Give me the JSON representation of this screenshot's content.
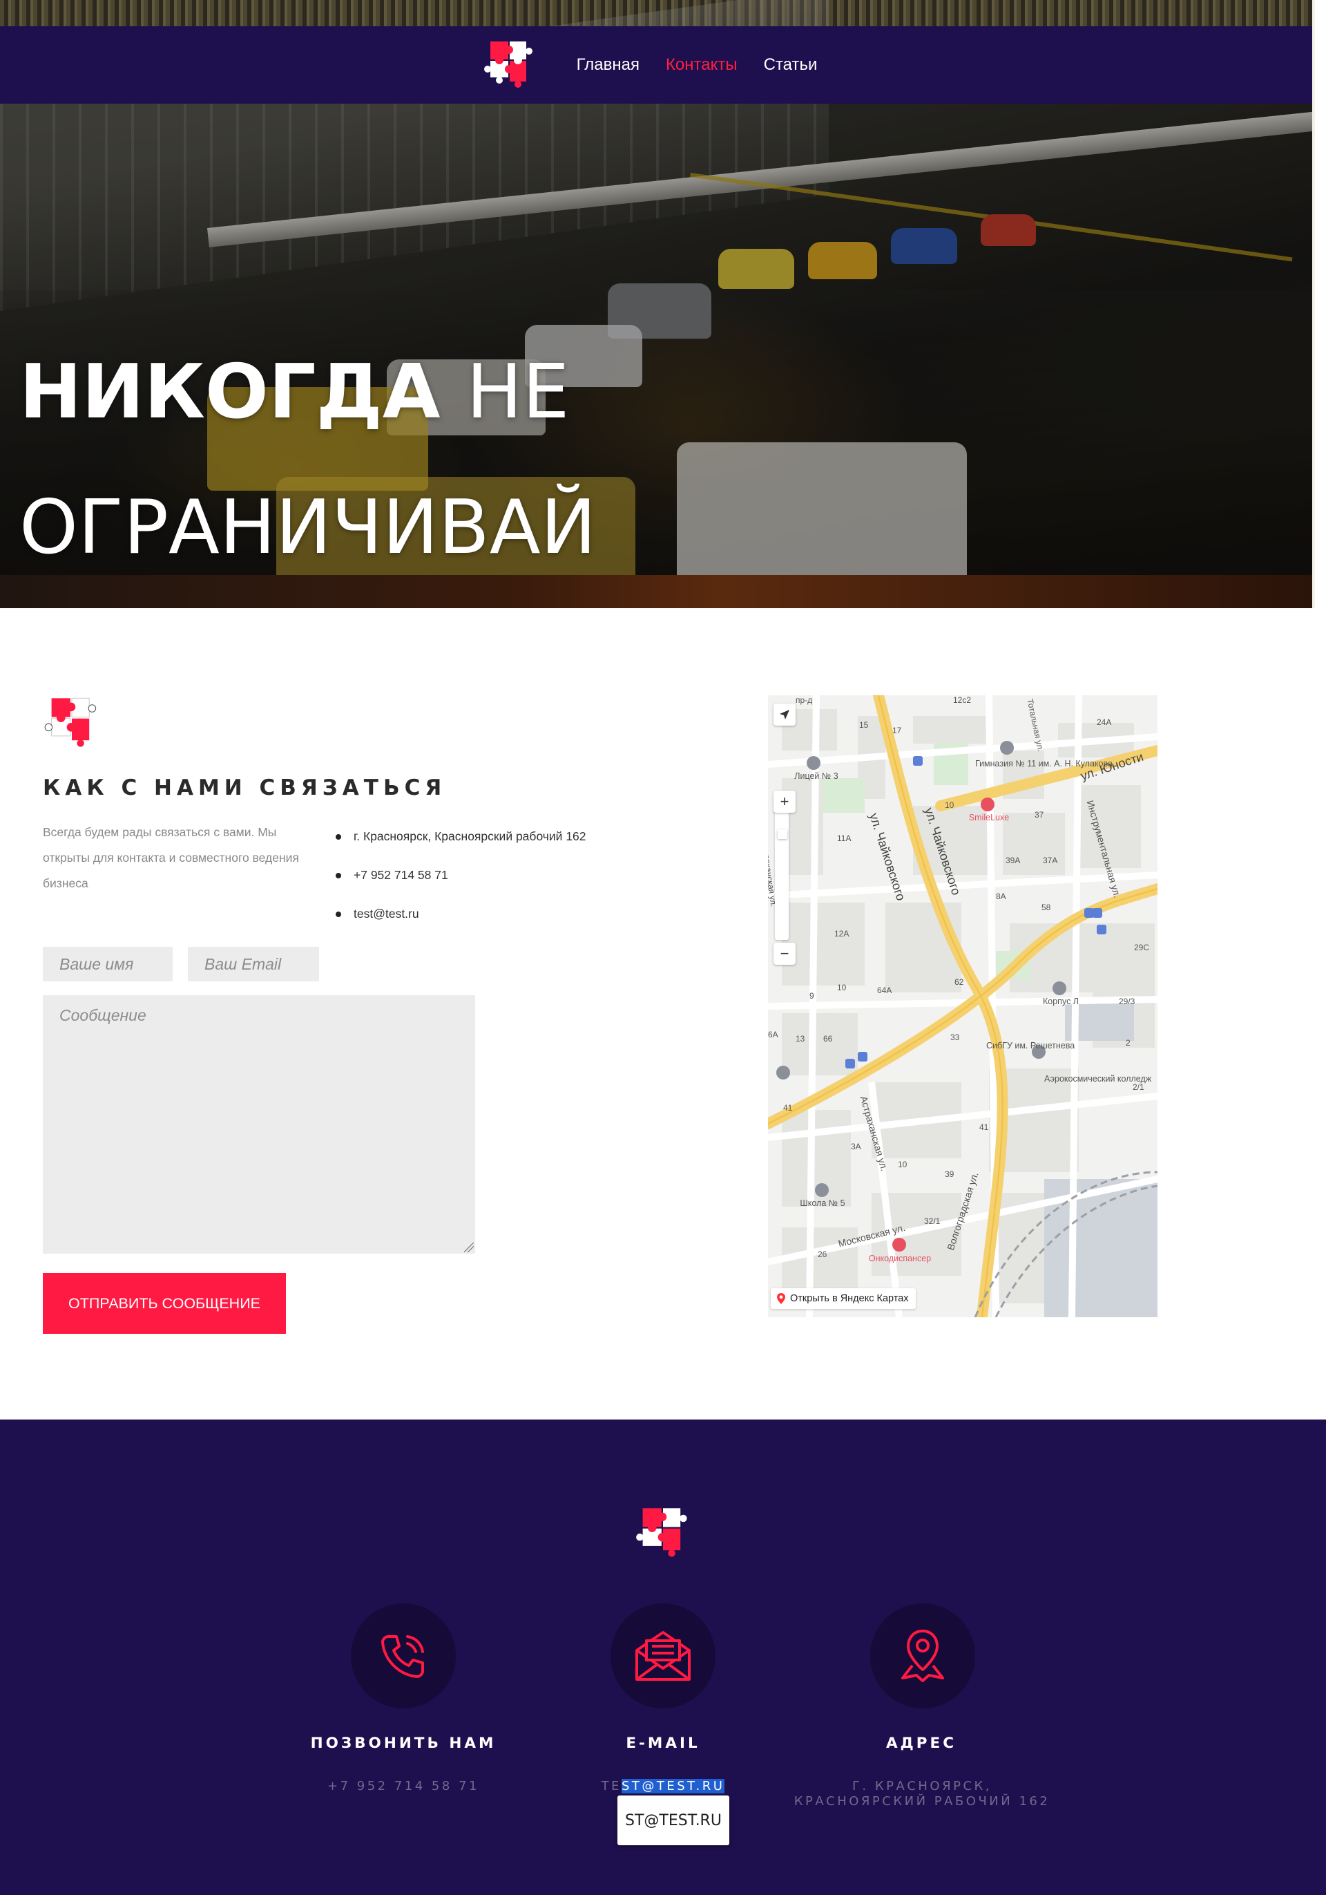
{
  "nav": {
    "links": [
      {
        "label": "Главная"
      },
      {
        "label": "Контакты"
      },
      {
        "label": "Статьи"
      }
    ],
    "active_color": "#ff1f3f",
    "background": "#1e0f4e"
  },
  "hero": {
    "title_bold": "НИКОГДА",
    "title_rest": "НЕ",
    "title_line2": "ОГРАНИЧИВАЙ"
  },
  "contact": {
    "heading": "КАК С НАМИ СВЯЗАТЬСЯ",
    "intro": "Всегда будем рады связаться с вами. Мы открыты для контакта и совместного ведения бизнеса",
    "info": [
      "г. Красноярск, Красноярский рабочий 162",
      "+7 952 714 58 71",
      "test@test.ru"
    ],
    "form": {
      "name_placeholder": "Ваше имя",
      "email_placeholder": "Ваш Email",
      "message_placeholder": "Сообщение",
      "submit_label": "Отправить сообщение"
    },
    "accent_color": "#ff1a43"
  },
  "map": {
    "open_link": "Открыть в Яндекс Картах",
    "streets": [
      "ул. Чайковского",
      "ул. Чайковского",
      "ул. Юности",
      "Инструментальная ул.",
      "Астраханская ул.",
      "Московская ул.",
      "Волгоградская ул.",
      "Астраханская ул.",
      "Тотальная ул.",
      "пр-д"
    ],
    "pois": [
      "Лицей № 3",
      "Гимназия № 11 им. А. Н. Кулакова",
      "SmileLuxe",
      "Корпус Л",
      "СибГУ им. Решетнева",
      "Аэрокосмический колледж",
      "Школа № 5",
      "Онкодиспансер"
    ],
    "house_numbers": [
      "12с2",
      "15",
      "17",
      "24А",
      "10",
      "11А",
      "39А",
      "37А",
      "8А",
      "12А",
      "64А",
      "62",
      "58",
      "29С",
      "29/3",
      "9",
      "10",
      "66",
      "33",
      "2",
      "2/1",
      "41",
      "41",
      "3А",
      "39",
      "32/1",
      "26",
      "37",
      "6А",
      "13",
      "10"
    ]
  },
  "footer": {
    "items": [
      {
        "title": "ПОЗВОНИТЬ НАМ",
        "value": "+7 952 714 58 71",
        "icon": "phone-icon"
      },
      {
        "title": "E-MAIL",
        "value_pre": "TE",
        "value_sel": "ST@TEST.RU",
        "icon": "mail-icon"
      },
      {
        "title": "АДРЕС",
        "value_line1": "Г. КРАСНОЯРСК,",
        "value_line2": "КРАСНОЯРСКИЙ РАБОЧИЙ 162",
        "icon": "location-pin-icon"
      }
    ],
    "tooltip": "ST@TEST.RU",
    "icon_color": "#ff1a43"
  }
}
